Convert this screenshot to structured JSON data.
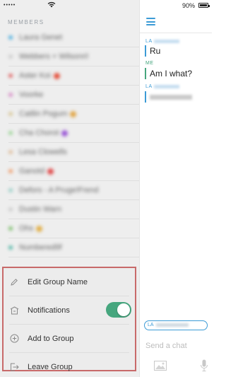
{
  "status": {
    "dots": "•••••",
    "time": "",
    "battery": "90%"
  },
  "members": {
    "title": "MEMBERS",
    "items": [
      {
        "name": "Laura Genet",
        "color": "#4fb0e0",
        "emoji": ""
      },
      {
        "name": "Webbers + Wilsonri!",
        "color": "#cccccc",
        "emoji": ""
      },
      {
        "name": "Aster Koi",
        "color": "#e06a6a",
        "emoji": "#e4533f"
      },
      {
        "name": "Voorke",
        "color": "#d890c8",
        "emoji": ""
      },
      {
        "name": "Caitlin Pogum",
        "color": "#d9c89a",
        "emoji": "#e1a84a"
      },
      {
        "name": "Cha Chorot",
        "color": "#9fd69a",
        "emoji": "#9b59d6"
      },
      {
        "name": "Lesa Clowells",
        "color": "#e0c0a0",
        "emoji": ""
      },
      {
        "name": "Ganotd",
        "color": "#f0a070",
        "emoji": "#e05050"
      },
      {
        "name": "Defors - A Pruge!Frend",
        "color": "#9bd0c8",
        "emoji": ""
      },
      {
        "name": "Dustin Warn",
        "color": "#cccccc",
        "emoji": ""
      },
      {
        "name": "Ohs",
        "color": "#7fc070",
        "emoji": "#e1b04a"
      },
      {
        "name": "Numbered9f",
        "color": "#58b8a8",
        "emoji": ""
      }
    ]
  },
  "actions": {
    "edit_group": "Edit Group Name",
    "notifications": "Notifications",
    "notifications_on": true,
    "add_to_group": "Add to Group",
    "leave_group": "Leave Group"
  },
  "chat": {
    "sender1": "LA",
    "msg1": "Ru",
    "sender_me": "ME",
    "msg2": "Am I what?",
    "sender2": "LA",
    "typing_label": "LA",
    "input_placeholder": "Send a chat"
  },
  "colors": {
    "accent_blue": "#3c9bd6",
    "accent_green": "#46a67e",
    "highlight_border": "#c86a6a"
  }
}
